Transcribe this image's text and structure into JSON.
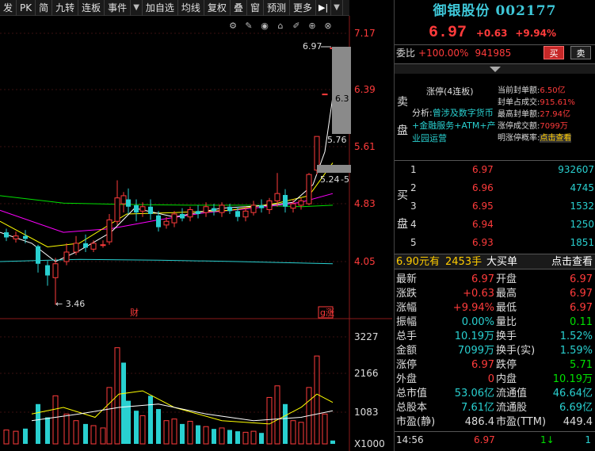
{
  "toolbar": {
    "items": [
      "发",
      "PK",
      "简",
      "九转",
      "连板",
      "事件",
      "▼",
      "加自选",
      "均线",
      "复权",
      "叠",
      "窗",
      "预测",
      "更多"
    ],
    "nav_label": "▶|",
    "dropdown_label": "▼"
  },
  "chart": {
    "price_ticks": [
      "7.17",
      "6.39",
      "5.61",
      "4.83",
      "4.05"
    ],
    "volume_ticks": [
      "3227",
      "2166",
      "1083",
      "X1000"
    ],
    "annotations": {
      "high": "6.97",
      "high_mark": "6.3",
      "mid": "5.76",
      "low_label": "5.24",
      "low_marker": "← 3.46",
      "dash": "-5"
    },
    "labels": {
      "cai": "财",
      "badge": "g涨"
    },
    "colors": {
      "up": "#ff3b3b",
      "down": "#29d0d0",
      "ma5": "#ffffff",
      "ma10": "#ffff00",
      "ma20": "#ff00ff",
      "ma60": "#00e000",
      "ma120": "#29d0d0"
    }
  },
  "stock": {
    "name": "御银股份",
    "code": "002177",
    "price": "6.97",
    "change": "+0.63",
    "change_pct": "+9.94%"
  },
  "weibi": {
    "label": "委比",
    "pct": "+100.00%",
    "diff": "941985",
    "buy_btn": "买",
    "sell_btn": "卖"
  },
  "sell_panel": {
    "side": "卖盘",
    "zhangting": "涨停(4连板)",
    "analysis_label": "分析:",
    "analysis_text": "曾涉及数字货币+金融服务+ATM+产业园运营",
    "stats": [
      {
        "k": "当前封单额:",
        "v": "6.50亿"
      },
      {
        "k": "封单占成交:",
        "v": "915.61%"
      },
      {
        "k": "最高封单额:",
        "v": "27.94亿"
      },
      {
        "k": "涨停成交额:",
        "v": "7099万"
      },
      {
        "k": "明涨停概率:",
        "v": "点击查看"
      }
    ]
  },
  "buy_panel": {
    "side": "买盘",
    "rows": [
      {
        "lv": "1",
        "pr": "6.97",
        "vol": "932607"
      },
      {
        "lv": "2",
        "pr": "6.96",
        "vol": "4745"
      },
      {
        "lv": "3",
        "pr": "6.95",
        "vol": "1532"
      },
      {
        "lv": "4",
        "pr": "6.94",
        "vol": "1250"
      },
      {
        "lv": "5",
        "pr": "6.93",
        "vol": "1851"
      }
    ]
  },
  "bigbuy": {
    "price": "6.90元有",
    "qty": "2453手",
    "label": "大买单",
    "link": "点击查看"
  },
  "quote": [
    {
      "k1": "最新",
      "v1": "6.97",
      "c1": "red",
      "k2": "开盘",
      "v2": "6.97",
      "c2": "red"
    },
    {
      "k1": "涨跌",
      "v1": "+0.63",
      "c1": "red",
      "k2": "最高",
      "v2": "6.97",
      "c2": "red"
    },
    {
      "k1": "涨幅",
      "v1": "+9.94%",
      "c1": "red",
      "k2": "最低",
      "v2": "6.97",
      "c2": "red"
    },
    {
      "k1": "振幅",
      "v1": "0.00%",
      "c1": "cyn",
      "k2": "量比",
      "v2": "0.11",
      "c2": "grn"
    },
    {
      "k1": "总手",
      "v1": "10.19万",
      "c1": "cyn",
      "k2": "换手",
      "v2": "1.52%",
      "c2": "cyn"
    },
    {
      "k1": "金额",
      "v1": "7099万",
      "c1": "cyn",
      "k2": "换手(实)",
      "v2": "1.59%",
      "c2": "cyn"
    },
    {
      "k1": "涨停",
      "v1": "6.97",
      "c1": "red",
      "k2": "跌停",
      "v2": "5.71",
      "c2": "grn"
    },
    {
      "k1": "外盘",
      "v1": "0",
      "c1": "red",
      "k2": "内盘",
      "v2": "10.19万",
      "c2": "grn"
    },
    {
      "k1": "总市值",
      "v1": "53.06亿",
      "c1": "cyn",
      "k2": "流通值",
      "v2": "46.64亿",
      "c2": "cyn"
    },
    {
      "k1": "总股本",
      "v1": "7.61亿",
      "c1": "cyn",
      "k2": "流通股",
      "v2": "6.69亿",
      "c2": "cyn"
    },
    {
      "k1": "市盈(静)",
      "v1": "486.4",
      "c1": "wht",
      "k2": "市盈(TTM)",
      "v2": "449.4",
      "c2": "wht"
    }
  ],
  "tick": {
    "time": "14:56",
    "price": "6.97",
    "num": "1",
    "arrow": "↓",
    "flag": "1"
  }
}
